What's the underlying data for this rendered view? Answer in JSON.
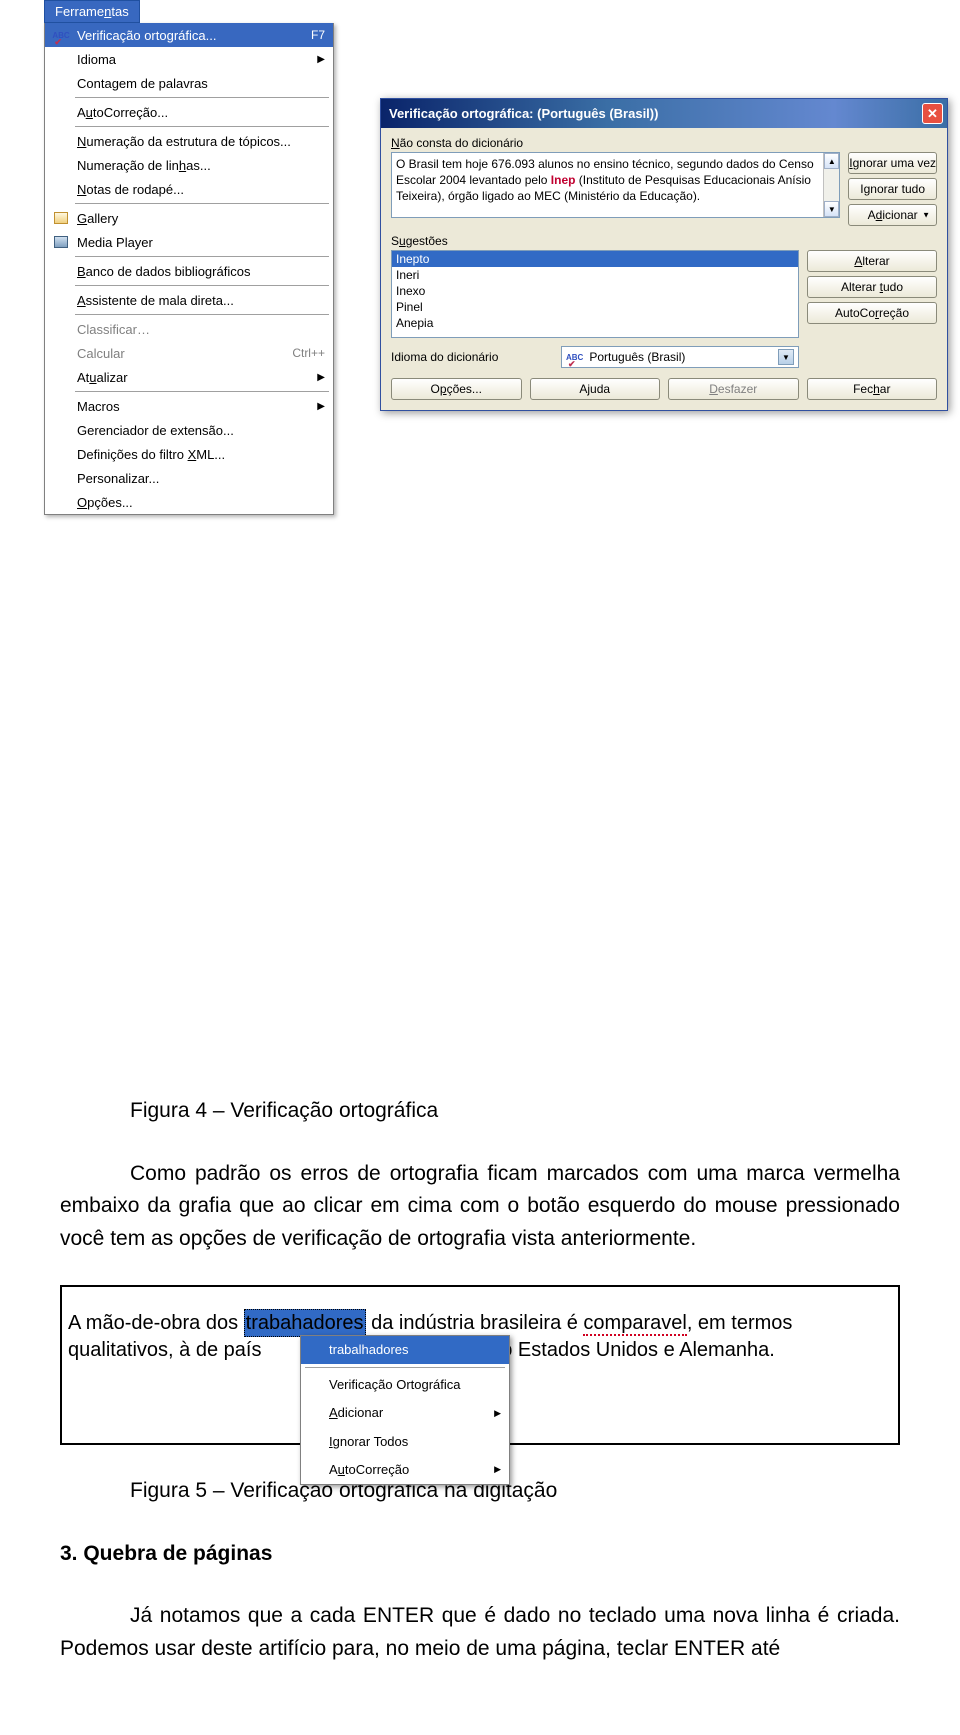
{
  "menu": {
    "title_pre": "Ferrame",
    "title_ul": "n",
    "title_post": "tas",
    "items": [
      {
        "icon": "abc",
        "label": "Verificação ortográfica...",
        "shortcut": "F7",
        "highlighted": true
      },
      {
        "label": "Idioma",
        "arrow": true
      },
      {
        "label": "Contagem de palavras"
      },
      {
        "sep": true
      },
      {
        "label_pre": "A",
        "label_ul": "u",
        "label_post": "toCorreção..."
      },
      {
        "sep": true
      },
      {
        "label_pre": "",
        "label_ul": "N",
        "label_post": "umeração da estrutura de tópicos..."
      },
      {
        "label_pre": "Numeração de lin",
        "label_ul": "h",
        "label_post": "as..."
      },
      {
        "label_pre": "",
        "label_ul": "N",
        "label_post": "otas de rodapé..."
      },
      {
        "sep": true
      },
      {
        "icon": "gallery",
        "label": "Gallery",
        "ul": "G"
      },
      {
        "icon": "media",
        "label": "Media Player"
      },
      {
        "sep": true
      },
      {
        "label_pre": "",
        "label_ul": "B",
        "label_post": "anco de dados bibliográficos"
      },
      {
        "sep": true
      },
      {
        "label_pre": "",
        "label_ul": "A",
        "label_post": "ssistente de mala direta..."
      },
      {
        "sep": true
      },
      {
        "label": "Classificar…",
        "disabled": true
      },
      {
        "label": "Calcular",
        "shortcut": "Ctrl++",
        "disabled": true
      },
      {
        "label_pre": "At",
        "label_ul": "u",
        "label_post": "alizar",
        "arrow": true
      },
      {
        "sep": true
      },
      {
        "label": "Macros",
        "arrow": true
      },
      {
        "label": "Gerenciador de extensão..."
      },
      {
        "label_pre": "Definições do filtro ",
        "label_ul": "X",
        "label_post": "ML..."
      },
      {
        "label": "Personalizar..."
      },
      {
        "label_pre": "",
        "label_ul": "O",
        "label_post": "pções..."
      }
    ]
  },
  "dialog": {
    "title": "Verificação ortográfica:  (Português (Brasil))",
    "nao_consta_pre": "",
    "nao_consta_ul": "N",
    "nao_consta_post": "ão consta do dicionário",
    "sample_text_a": "O Brasil tem hoje 676.093 alunos no ensino técnico, segundo dados do Censo Escolar 2004 levantado pelo ",
    "sample_text_red": "Inep",
    "sample_text_b": " (Instituto de Pesquisas Educacionais Anísio Teixeira), órgão ligado ao MEC (Ministério da Educação).",
    "sugestoes_pre": "S",
    "sugestoes_ul": "u",
    "sugestoes_post": "gestões",
    "suggestions": [
      "Inepto",
      "Ineri",
      "Inexo",
      "Pinel",
      "Anepia"
    ],
    "idioma_label": "Idioma do dicionário",
    "idioma_value": "Português (Brasil)",
    "buttons": {
      "ignorar_uma": "Ignorar uma vez",
      "ignorar_uma_ul": "I",
      "ignorar_tudo": "Ignorar tudo",
      "adicionar": "Adicionar",
      "adicionar_ul": "d",
      "alterar": "Alterar",
      "alterar_ul": "A",
      "alterar_tudo": "Alterar tudo",
      "alterar_tudo_ul": "t",
      "autocorrecao": "AutoCorreção",
      "autocorrecao_ul": "r",
      "opcoes": "Opções...",
      "opcoes_ul": "p",
      "ajuda": "Ajuda",
      "desfazer": "Desfazer",
      "desfazer_ul": "D",
      "fechar": "Fechar",
      "fechar_ul": "h"
    }
  },
  "doc": {
    "fig4": "Figura 4 – Verificação ortográfica",
    "para1": "Como padrão os erros de ortografia ficam marcados com uma marca vermelha embaixo da grafia que ao clicar em cima com o botão esquerdo do mouse pressionado você tem as opções de verificação de ortografia vista anteriormente.",
    "fig5": "Figura 5 – Verificação ortográfica na digitação",
    "sec3": "3. Quebra de páginas",
    "para_last": "Já notamos que a cada ENTER que é dado no teclado uma nova linha é criada. Podemos usar deste artifício para, no meio de uma página, teclar ENTER até"
  },
  "ctx": {
    "line_a": "A mão-de-obra dos ",
    "err_word": "trabahadores",
    "line_b": " da indústria brasileira é ",
    "err2": "comparavel",
    "line_c": ", em termos",
    "line2_a": "qualitativos, à de país",
    "line2_hidden": "omo Estados Unidos e Alemanha.",
    "sugg": "trabalhadores",
    "items": [
      {
        "label": "Verificação Ortográfica"
      },
      {
        "label_pre": "",
        "label_ul": "A",
        "label_post": "dicionar",
        "arrow": true
      },
      {
        "label_pre": "",
        "label_ul": "I",
        "label_post": "gnorar Todos"
      },
      {
        "label_pre": "A",
        "label_ul": "u",
        "label_post": "toCorreção",
        "arrow": true
      }
    ]
  }
}
